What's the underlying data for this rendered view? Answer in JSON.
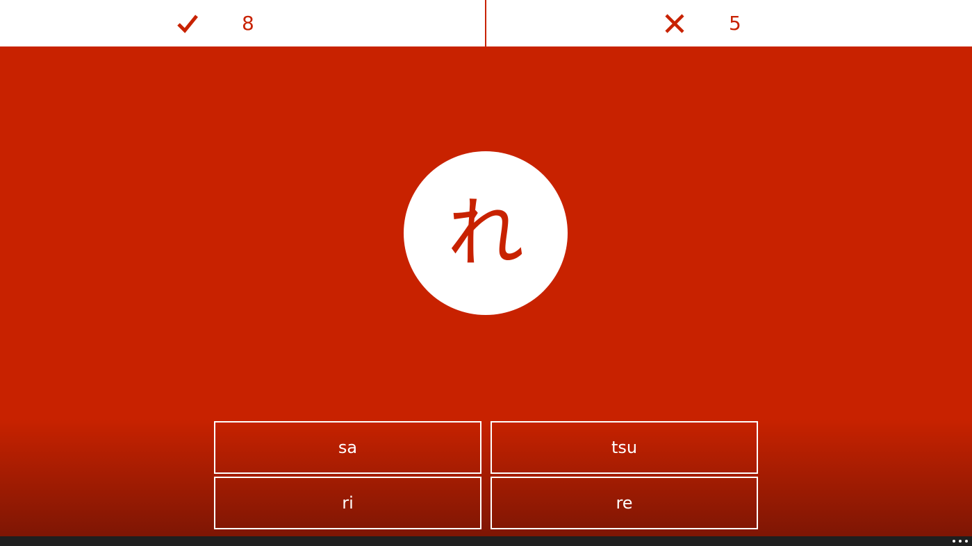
{
  "scores": {
    "correct": {
      "icon": "check-icon",
      "count": "8"
    },
    "incorrect": {
      "icon": "close-icon",
      "count": "5"
    }
  },
  "question": {
    "character": "れ"
  },
  "answers": [
    {
      "label": "sa"
    },
    {
      "label": "tsu"
    },
    {
      "label": "ri"
    },
    {
      "label": "re"
    }
  ],
  "appbar": {
    "more_icon": "more-icon"
  },
  "colors": {
    "accent": "#c82200",
    "background_bottom": "#7e1604",
    "surface": "#ffffff",
    "appbar": "#1f1f1f"
  }
}
